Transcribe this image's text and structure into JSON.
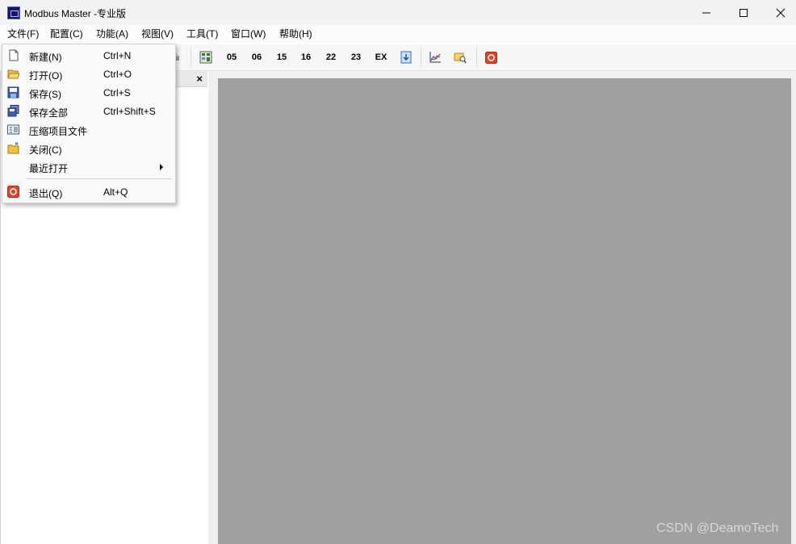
{
  "window": {
    "title": "Modbus Master -专业版"
  },
  "menubar": {
    "items": [
      {
        "label": "文件(F)"
      },
      {
        "label": "配置(C)"
      },
      {
        "label": "功能(A)"
      },
      {
        "label": "视图(V)"
      },
      {
        "label": "工具(T)"
      },
      {
        "label": "窗口(W)"
      },
      {
        "label": "帮助(H)"
      }
    ]
  },
  "toolbar": {
    "function_codes": [
      "05",
      "06",
      "15",
      "16",
      "22",
      "23",
      "EX"
    ]
  },
  "file_menu": {
    "items": [
      {
        "label": "新建(N)",
        "shortcut": "Ctrl+N",
        "icon": "new-document-icon"
      },
      {
        "label": "打开(O)",
        "shortcut": "Ctrl+O",
        "icon": "open-folder-icon"
      },
      {
        "label": "保存(S)",
        "shortcut": "Ctrl+S",
        "icon": "save-icon"
      },
      {
        "label": "保存全部",
        "shortcut": "Ctrl+Shift+S",
        "icon": "save-all-icon"
      },
      {
        "label": "压缩项目文件",
        "shortcut": "",
        "icon": "compress-project-icon"
      },
      {
        "label": "关闭(C)",
        "shortcut": "",
        "icon": "close-folder-icon"
      },
      {
        "label": "最近打开",
        "shortcut": "",
        "icon": "",
        "submenu": true
      },
      {
        "label": "退出(Q)",
        "shortcut": "Alt+Q",
        "icon": "exit-icon"
      }
    ]
  },
  "panel": {
    "close_glyph": "×"
  },
  "watermark": "CSDN @DeamoTech",
  "colors": {
    "mdi_background": "#a0a0a0",
    "menu_background": "#f9f9f9",
    "exit_icon": "#e0452a"
  }
}
